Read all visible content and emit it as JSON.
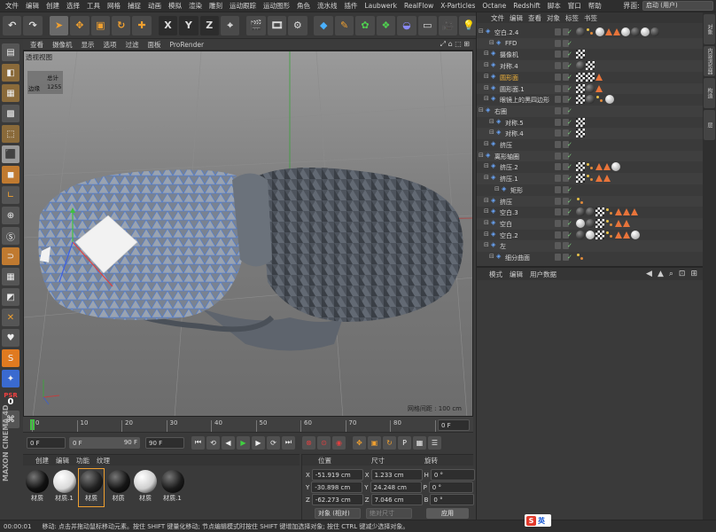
{
  "menu": [
    "文件",
    "编辑",
    "创建",
    "选择",
    "工具",
    "网格",
    "捕捉",
    "动画",
    "模拟",
    "渲染",
    "雕刻",
    "运动跟踪",
    "运动图形",
    "角色",
    "流水线",
    "插件",
    "Laubwerk",
    "RealFlow",
    "X-Particles",
    "Octane",
    "Redshift",
    "脚本",
    "窗口",
    "帮助"
  ],
  "interface_label": "界面:",
  "interface_value": "启动 (用户)",
  "viewport_menu": [
    "查看",
    "摄像机",
    "显示",
    "选项",
    "过滤",
    "面板",
    "ProRender"
  ],
  "viewport_title": "透视视图",
  "stats": {
    "total_label": "总计",
    "edges_label": "边缘",
    "edges_value": "1255"
  },
  "grid_info": "网格间距 : 100 cm",
  "timeline": {
    "ticks": [
      "0",
      "10",
      "20",
      "30",
      "40",
      "50",
      "60",
      "70",
      "80",
      "90"
    ],
    "end_field": "0 F"
  },
  "playbar": {
    "start": "0 F",
    "min": "0 F",
    "max": "90 F",
    "end": "90 F"
  },
  "material_tabs": [
    "创建",
    "编辑",
    "功能",
    "纹理"
  ],
  "materials": [
    {
      "label": "材质",
      "color": "#111"
    },
    {
      "label": "材质.1",
      "color": "#d9d9d9"
    },
    {
      "label": "材质",
      "color": "#222"
    },
    {
      "label": "材质",
      "color": "#151515"
    },
    {
      "label": "材质",
      "color": "#cfcfcf"
    },
    {
      "label": "材质.1",
      "color": "#1b1b1b"
    }
  ],
  "coords": {
    "headers": [
      "位置",
      "尺寸",
      "旋转"
    ],
    "rows": [
      {
        "axis": "X",
        "pos": "-51.919 cm",
        "axis2": "X",
        "size": "1.233 cm",
        "axis3": "H",
        "rot": "0 °"
      },
      {
        "axis": "Y",
        "pos": "-30.898 cm",
        "axis2": "Y",
        "size": "24.248 cm",
        "axis3": "P",
        "rot": "0 °"
      },
      {
        "axis": "Z",
        "pos": "-62.273 cm",
        "axis2": "Z",
        "size": "7.046 cm",
        "axis3": "B",
        "rot": "0 °"
      }
    ],
    "mode": "对象 (相对)",
    "size_mode": "绝对尺寸",
    "apply": "应用"
  },
  "object_menu": [
    "文件",
    "编辑",
    "查看",
    "对象",
    "标签",
    "书签"
  ],
  "objects": [
    {
      "name": "空白.2.4",
      "indent": 0,
      "hl": false
    },
    {
      "name": "FFD",
      "indent": 2,
      "hl": false
    },
    {
      "name": "摄像机",
      "indent": 1,
      "hl": false
    },
    {
      "name": "对称.4",
      "indent": 1,
      "hl": false
    },
    {
      "name": "圆形面",
      "indent": 1,
      "hl": true
    },
    {
      "name": "圆形面.1",
      "indent": 1,
      "hl": false
    },
    {
      "name": "眼镜上的黑四边形",
      "indent": 1,
      "hl": false
    },
    {
      "name": "右圈",
      "indent": 0,
      "hl": false
    },
    {
      "name": "对称.5",
      "indent": 2,
      "hl": false
    },
    {
      "name": "对称.4",
      "indent": 2,
      "hl": false
    },
    {
      "name": "挤压",
      "indent": 1,
      "hl": false
    },
    {
      "name": "离形轴圈",
      "indent": 0,
      "hl": false
    },
    {
      "name": "挤压.2",
      "indent": 1,
      "hl": false
    },
    {
      "name": "挤压.1",
      "indent": 1,
      "hl": false
    },
    {
      "name": "矩形",
      "indent": 3,
      "hl": false
    },
    {
      "name": "挤压",
      "indent": 1,
      "hl": false
    },
    {
      "name": "空白.3",
      "indent": 1,
      "hl": false
    },
    {
      "name": "空白",
      "indent": 1,
      "hl": false
    },
    {
      "name": "空白.2",
      "indent": 1,
      "hl": false
    },
    {
      "name": "左",
      "indent": 1,
      "hl": false
    },
    {
      "name": "细分曲面",
      "indent": 2,
      "hl": false
    }
  ],
  "attr_menu": [
    "模式",
    "编辑",
    "用户数据"
  ],
  "right_strip": [
    "对象",
    "内容浏览器",
    "构造",
    "层"
  ],
  "status": {
    "time": "00:00:01",
    "text": "移动: 点击并拖动鼠标移动元素。按住 SHIFT 键量化移动; 节点编辑模式时按住 SHIFT 键增加选择对象; 按住 CTRL 键减少选择对象。"
  },
  "ime": {
    "logo": "S",
    "lang": "英"
  },
  "left_psr": "PSR",
  "left_psr_val": "0",
  "logo_text": "MAXON CINEMA 4D"
}
